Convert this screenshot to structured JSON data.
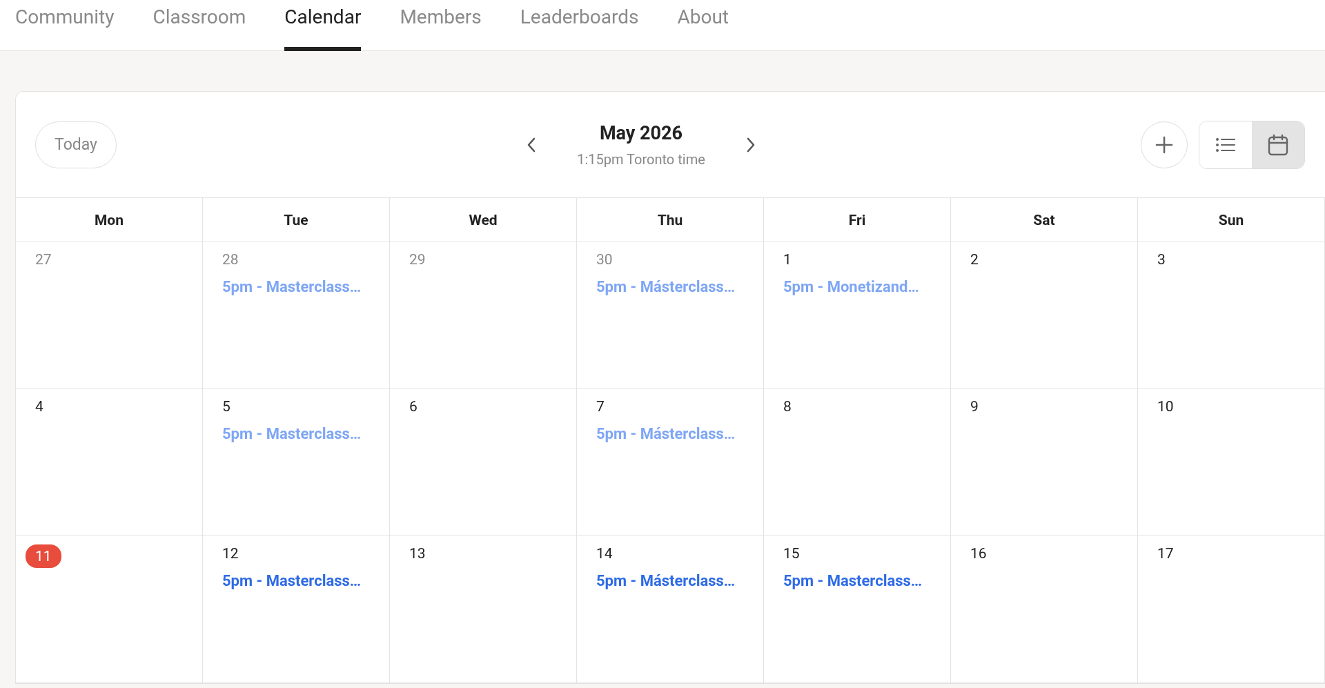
{
  "tabs": [
    {
      "label": "Community",
      "selected": false
    },
    {
      "label": "Classroom",
      "selected": false
    },
    {
      "label": "Calendar",
      "selected": true
    },
    {
      "label": "Members",
      "selected": false
    },
    {
      "label": "Leaderboards",
      "selected": false
    },
    {
      "label": "About",
      "selected": false
    }
  ],
  "calendar": {
    "today_button": "Today",
    "month": "May 2026",
    "local_time": "1:15pm Toronto time",
    "views": [
      {
        "kind": "list",
        "selected": false
      },
      {
        "kind": "calendar",
        "selected": true
      }
    ],
    "weekdays": [
      "Mon",
      "Tue",
      "Wed",
      "Thu",
      "Fri",
      "Sat",
      "Sun"
    ],
    "weeks": [
      {
        "days": [
          {
            "date": "27",
            "other_month": true,
            "today": false
          },
          {
            "date": "28",
            "other_month": true,
            "today": false,
            "events": [
              {
                "label": "5pm - Masterclass…",
                "past": true
              }
            ]
          },
          {
            "date": "29",
            "other_month": true,
            "today": false
          },
          {
            "date": "30",
            "other_month": true,
            "today": false,
            "events": [
              {
                "label": "5pm - Másterclass…",
                "past": true
              }
            ]
          },
          {
            "date": "1",
            "other_month": false,
            "today": false,
            "events": [
              {
                "label": "5pm - Monetizand…",
                "past": true
              }
            ]
          },
          {
            "date": "2",
            "other_month": false,
            "today": false
          },
          {
            "date": "3",
            "other_month": false,
            "today": false
          }
        ]
      },
      {
        "days": [
          {
            "date": "4",
            "other_month": false,
            "today": false
          },
          {
            "date": "5",
            "other_month": false,
            "today": false,
            "events": [
              {
                "label": "5pm - Masterclass…",
                "past": true
              }
            ]
          },
          {
            "date": "6",
            "other_month": false,
            "today": false
          },
          {
            "date": "7",
            "other_month": false,
            "today": false,
            "events": [
              {
                "label": "5pm - Másterclass…",
                "past": true
              }
            ]
          },
          {
            "date": "8",
            "other_month": false,
            "today": false
          },
          {
            "date": "9",
            "other_month": false,
            "today": false
          },
          {
            "date": "10",
            "other_month": false,
            "today": false
          }
        ]
      },
      {
        "days": [
          {
            "date": "11",
            "other_month": false,
            "today": true
          },
          {
            "date": "12",
            "other_month": false,
            "today": false,
            "events": [
              {
                "label": "5pm - Masterclass…",
                "past": false
              }
            ]
          },
          {
            "date": "13",
            "other_month": false,
            "today": false
          },
          {
            "date": "14",
            "other_month": false,
            "today": false,
            "events": [
              {
                "label": "5pm - Másterclass…",
                "past": false
              }
            ]
          },
          {
            "date": "15",
            "other_month": false,
            "today": false,
            "events": [
              {
                "label": "5pm - Masterclass…",
                "past": false
              }
            ]
          },
          {
            "date": "16",
            "other_month": false,
            "today": false
          },
          {
            "date": "17",
            "other_month": false,
            "today": false
          }
        ]
      }
    ]
  }
}
